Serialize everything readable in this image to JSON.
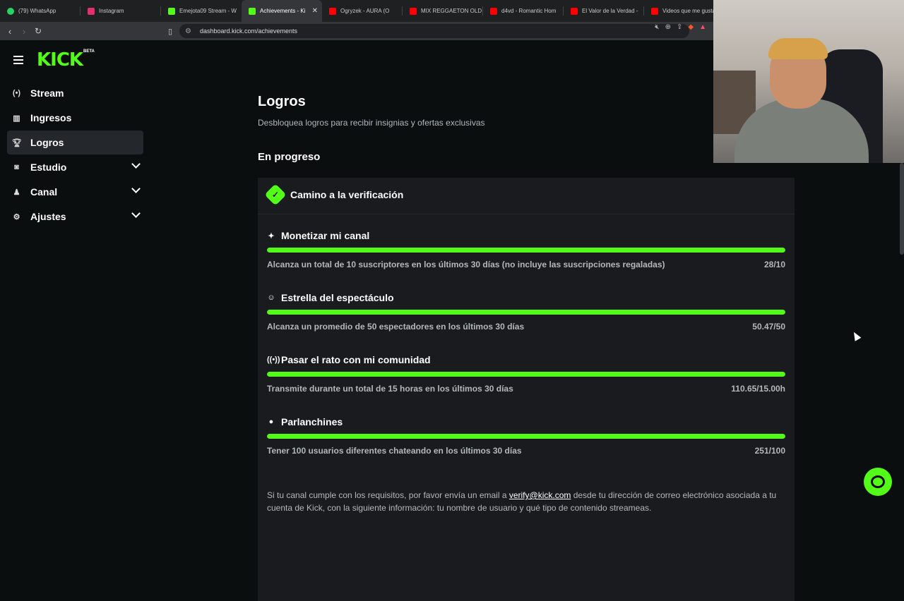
{
  "browser": {
    "tabs": [
      {
        "label": "(79) WhatsApp",
        "color": "#25d366"
      },
      {
        "label": "Instagram",
        "color": "#e1306c"
      },
      {
        "label": "Emejota09 Stream - W",
        "color": "#53fc18"
      },
      {
        "label": "Achievements - Ki",
        "color": "#53fc18",
        "active": true
      },
      {
        "label": "Ogryzek - AURA (O",
        "color": "#ff0000"
      },
      {
        "label": "MIX REGGAETON OLD",
        "color": "#ff0000"
      },
      {
        "label": "d4vd - Romantic Hom",
        "color": "#ff0000"
      },
      {
        "label": "El Valor de la Verdad -",
        "color": "#ff0000"
      },
      {
        "label": "Videos que me gusta",
        "color": "#ff0000"
      }
    ],
    "url": "dashboard.kick.com/achievements"
  },
  "app": {
    "logo": "KICK",
    "beta": "BETA"
  },
  "sidebar": {
    "items": [
      {
        "label": "Stream",
        "icon": "stream-icon"
      },
      {
        "label": "Ingresos",
        "icon": "chart-icon"
      },
      {
        "label": "Logros",
        "icon": "trophy-icon",
        "active": true
      },
      {
        "label": "Estudio",
        "icon": "studio-icon",
        "expandable": true
      },
      {
        "label": "Canal",
        "icon": "channel-icon",
        "expandable": true
      },
      {
        "label": "Ajustes",
        "icon": "gear-icon",
        "expandable": true
      }
    ]
  },
  "main": {
    "title": "Logros",
    "subtitle": "Desbloquea logros para recibir insignias y ofertas exclusivas",
    "section": "En progreso",
    "card_title": "Camino a la verificación",
    "achievements": [
      {
        "title": "Monetizar mi canal",
        "icon": "sparkle-icon",
        "desc": "Alcanza un total de 10 suscriptores en los últimos 30 días (no incluye las suscripciones regaladas)",
        "value": "28/10",
        "progress": 1.0
      },
      {
        "title": "Estrella del espectáculo",
        "icon": "user-star-icon",
        "desc": "Alcanza un promedio de 50 espectadores en los últimos 30 días",
        "value": "50.47/50",
        "progress": 1.0
      },
      {
        "title": "Pasar el rato con mi comunidad",
        "icon": "broadcast-icon",
        "desc": "Transmite durante un total de 15 horas en los últimos 30 días",
        "value": "110.65/15.00h",
        "progress": 1.0
      },
      {
        "title": "Parlanchines",
        "icon": "chat-icon",
        "desc": "Tener 100 usuarios diferentes chateando en los últimos 30 días",
        "value": "251/100",
        "progress": 1.0
      }
    ],
    "footnote_before": "Si tu canal cumple con los requisitos, por favor envía un email a ",
    "footnote_email": "verify@kick.com",
    "footnote_after": " desde tu dirección de correo electrónico asociada a tu cuenta de Kick, con la siguiente información: tu nombre de usuario y qué tipo de contenido streameas."
  },
  "colors": {
    "accent": "#53fc18",
    "background": "#0b0e0f",
    "card": "#191b1f"
  }
}
